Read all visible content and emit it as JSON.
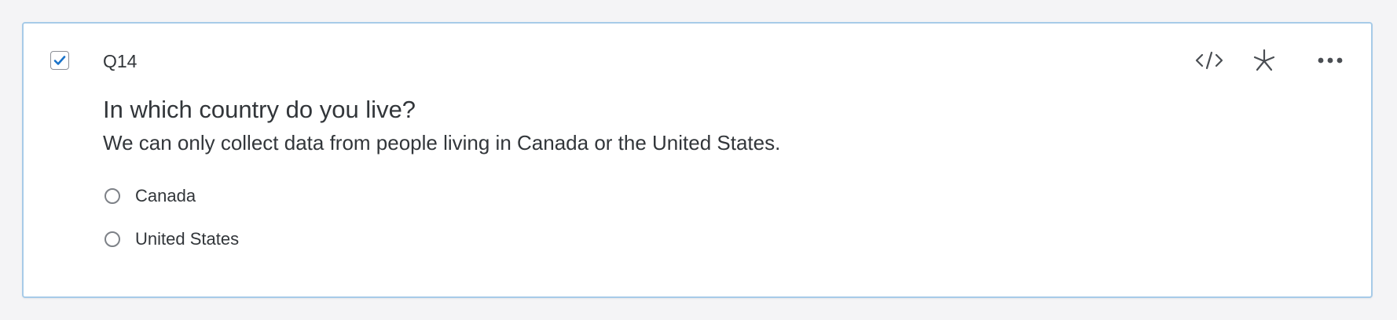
{
  "question": {
    "id": "Q14",
    "title": "In which country do you live?",
    "description": "We can only collect data from people living in Canada or the United States.",
    "selected": true,
    "choices": [
      {
        "label": "Canada",
        "checked": false
      },
      {
        "label": "United States",
        "checked": false
      }
    ]
  },
  "toolbar": {
    "icons": [
      "code-icon",
      "asterisk-icon",
      "more-icon"
    ]
  },
  "colors": {
    "card_border": "#a7cbe8",
    "checkbox_check": "#1a73c9",
    "text": "#32363a",
    "icon": "#4a4e53",
    "radio_border": "#7d8187"
  }
}
